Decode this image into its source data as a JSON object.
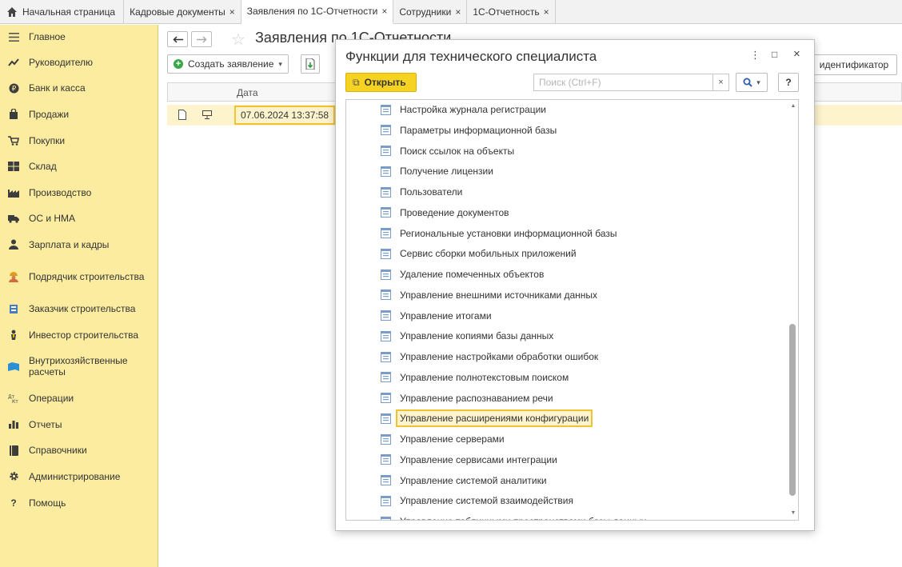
{
  "tabs": [
    {
      "label": "Начальная страница",
      "closable": false
    },
    {
      "label": "Кадровые документы",
      "closable": true
    },
    {
      "label": "Заявления по 1С-Отчетности",
      "closable": true,
      "active": true
    },
    {
      "label": "Сотрудники",
      "closable": true
    },
    {
      "label": "1С-Отчетность",
      "closable": true
    }
  ],
  "tab_close_glyph": "×",
  "sidebar": {
    "items": [
      {
        "label": "Главное",
        "icon": "menu-icon"
      },
      {
        "label": "Руководителю",
        "icon": "chart-trend-icon"
      },
      {
        "label": "Банк и касса",
        "icon": "ruble-coin-icon"
      },
      {
        "label": "Продажи",
        "icon": "shopping-bag-icon"
      },
      {
        "label": "Покупки",
        "icon": "cart-icon"
      },
      {
        "label": "Склад",
        "icon": "warehouse-icon"
      },
      {
        "label": "Производство",
        "icon": "factory-icon"
      },
      {
        "label": "ОС и НМА",
        "icon": "truck-icon"
      },
      {
        "label": "Зарплата и кадры",
        "icon": "person-icon"
      },
      {
        "label": "Подрядчик строительства",
        "icon": "builder-icon"
      },
      {
        "label": "Заказчик строительства",
        "icon": "customer-icon"
      },
      {
        "label": "Инвестор строительства",
        "icon": "investor-icon"
      },
      {
        "label": "Внутрихозяйственные расчеты",
        "icon": "settlement-icon"
      },
      {
        "label": "Операции",
        "icon": "dt-kt-icon"
      },
      {
        "label": "Отчеты",
        "icon": "bar-chart-icon"
      },
      {
        "label": "Справочники",
        "icon": "book-icon"
      },
      {
        "label": "Администрирование",
        "icon": "gear-icon"
      },
      {
        "label": "Помощь",
        "icon": "question-icon"
      }
    ]
  },
  "main": {
    "title": "Заявления по 1С-Отчетности",
    "create_button": "Создать заявление",
    "id_button": "идентификатор",
    "grid": {
      "column_date": "Дата",
      "rows": [
        {
          "date": "07.06.2024 13:37:58"
        }
      ]
    }
  },
  "modal": {
    "title": "Функции для технического специалиста",
    "open_button": "Открыть",
    "search_placeholder": "Поиск (Ctrl+F)",
    "search_clear": "×",
    "help_label": "?",
    "items": [
      "Настройка журнала регистрации",
      "Параметры информационной базы",
      "Поиск ссылок на объекты",
      "Получение лицензии",
      "Пользователи",
      "Проведение документов",
      "Региональные установки информационной базы",
      "Сервис сборки мобильных приложений",
      "Удаление помеченных объектов",
      "Управление внешними источниками данных",
      "Управление итогами",
      "Управление копиями базы данных",
      "Управление настройками обработки ошибок",
      "Управление полнотекстовым поиском",
      "Управление распознаванием речи",
      "Управление расширениями конфигурации",
      "Управление серверами",
      "Управление сервисами интеграции",
      "Управление системой аналитики",
      "Управление системой взаимодействия",
      "Управление табличными пространствами базы данных"
    ],
    "selected_index": 15
  },
  "colors": {
    "sidebar_bg": "#fbeca0",
    "accent_yellow": "#f6d323",
    "selection_border": "#f1c232",
    "selection_bg": "#fdf3cc"
  }
}
